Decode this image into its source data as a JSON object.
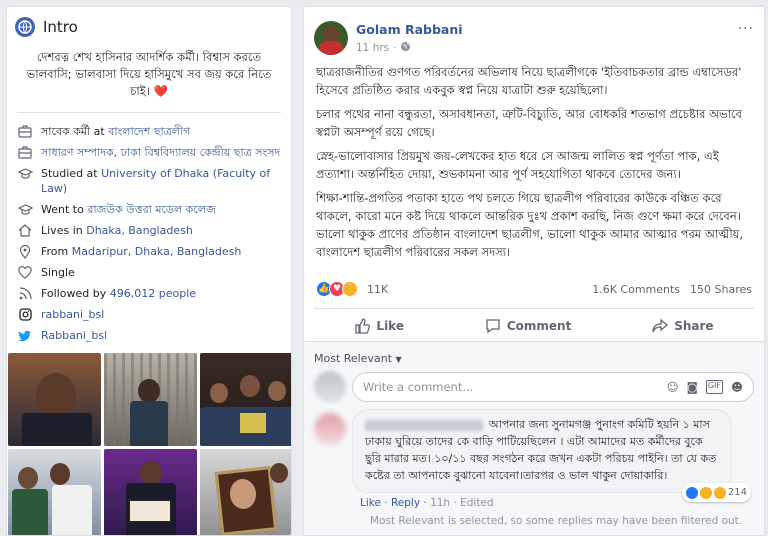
{
  "intro": {
    "title": "Intro",
    "bio": "দেশরত্ন শেখ হাসিনার আদর্শিক কর্মী। বিশ্বাস করতে ভালবাসি; ভালবাসা দিয়ে হাসিমুখে সব জয় করে নিতে চাই।",
    "bio_heart": "❤️",
    "items": [
      {
        "icon": "briefcase-icon",
        "prefix": "সাবেক কর্মী at ",
        "link": "বাংলাদেশ ছাত্রলীগ"
      },
      {
        "icon": "briefcase-icon",
        "prefix": "",
        "link": "সাধারণ সম্পাদক, ঢাকা বিশ্ববিদ্যালয় কেন্দ্রীয় ছাত্র সংসদ"
      },
      {
        "icon": "graduation-cap-icon",
        "prefix": "Studied at ",
        "link": "University of Dhaka (Faculty of Law)"
      },
      {
        "icon": "graduation-cap-icon",
        "prefix": "Went to ",
        "link": "রাজউক উত্তরা মডেল কলেজ"
      },
      {
        "icon": "home-icon",
        "prefix": "Lives in ",
        "link": "Dhaka, Bangladesh"
      },
      {
        "icon": "location-pin-icon",
        "prefix": "From ",
        "link": "Madaripur, Dhaka, Bangladesh"
      },
      {
        "icon": "heart-icon",
        "prefix": "Single",
        "link": ""
      },
      {
        "icon": "rss-icon",
        "prefix": "Followed by ",
        "link": "496,012 people"
      },
      {
        "icon": "instagram-icon",
        "prefix": "",
        "link": "rabbani_bsl"
      },
      {
        "icon": "twitter-icon",
        "prefix": "",
        "link": "Rabbani_bsl"
      }
    ]
  },
  "post": {
    "author": "Golam Rabbani",
    "time": "11 hrs",
    "more": "···",
    "paragraphs": [
      "ছাত্ররাজনীতির গুণগত পরিবর্তনের অভিলাষ নিয়ে ছাত্রলীগকে 'ইতিবাচকতার ব্রান্ড এম্বাসেডর' হিসেবে প্রতিষ্ঠিত করার একবুক স্বপ্ন নিয়ে যাত্রাটা শুরু হয়েছিলো।",
      "চলার পথের নানা বন্ধুরতা, অসাবধানতা, ত্রুটি-বিচ্যুতি, আর বোধকরি শতভাগ প্রচেষ্টার অভাবে স্বপ্নটা অসম্পূর্ণ রয়ে গেছে।",
      "স্নেহ-ভালোবাসার প্রিয়মুখ জয়-লেখকের হাত ধরে সে আজন্ম লালিত স্বপ্ন পূর্ণতা পাক, এই প্রত্যাশা। অন্তর্নিহিত দোয়া, শুভকামনা আর পূর্ণ সহযোগিতা থাকবে তোদের জন্য।",
      "শিক্ষা-শান্তি-প্রগতির পতাকা হাতে পথ চলতে গিয়ে ছাত্রলীগ পরিবারের কাউকে বঞ্চিত করে থাকলে, কারো মনে কষ্ট দিয়ে থাকলে আন্তরিক দুঃখ প্রকাশ করছি, নিজ গুণে ক্ষমা করে দেবেন। ভালো থাকুক প্রাণের প্রতিষ্ঠান বাংলাদেশ ছাত্রলীগ, ভালো থাকুক আমার আত্মার পরম আত্মীয়, বাংলাদেশ ছাত্রলীগ পরিবারের সকল সদস্য।"
    ],
    "reactions_count": "11K",
    "comments_count": "1.6K Comments",
    "shares_count": "150 Shares",
    "like_label": "Like",
    "comment_label": "Comment",
    "share_label": "Share"
  },
  "comments": {
    "sort_label": "Most Relevant",
    "placeholder": "Write a comment...",
    "first": {
      "text_line1": "আপনার জন্য সুনামগঞ্জ পুনাংগ কমিটি হয়নি ১ মাস ঢাকায় ঘুরিয়ে তাদের কে বাড়ি পাটিয়েছিলেন । এটা আমাদের মত কর্মীদের বুকে ছুরি মারার মত। ১০/১১ বছর সংগঠন করে জখন একটা পরিচয় পাইনি। তা যে কত কষ্টের তা আপনাকে বুঝানো যাবেনা।তারপর ও ভাল থাকুন দোয়াকারি।",
      "reaction_count": "214",
      "like": "Like",
      "reply": "Reply",
      "time": "11h",
      "edited": "Edited"
    },
    "footer": "Most Relevant is selected, so some replies may have been filtered out."
  },
  "colors": {
    "link": "#385898",
    "fb_blue": "#4267b2",
    "like_blue": "#2078f4",
    "love_red": "#f33e58",
    "haha_yellow": "#f7b125"
  }
}
